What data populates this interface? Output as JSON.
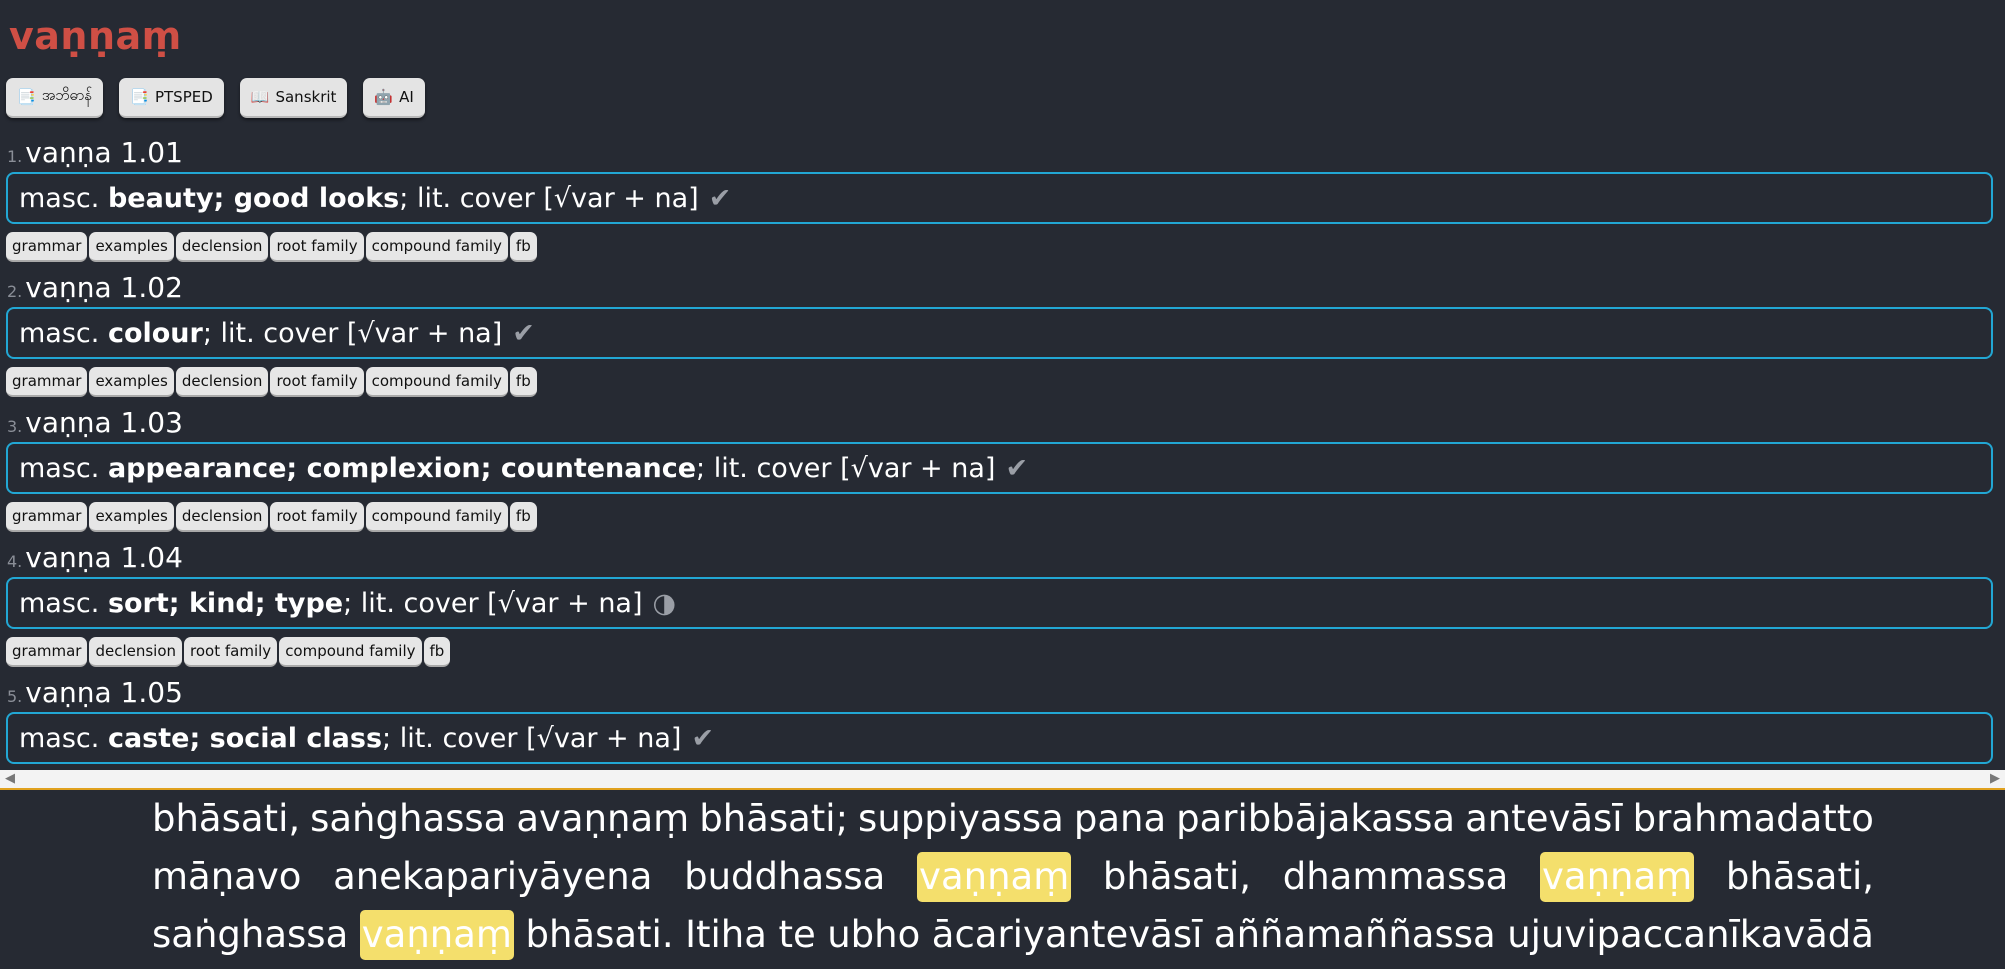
{
  "headword": "vaṇṇaṃ",
  "toolbar": [
    {
      "icon": "📑",
      "label": "အဘိဓာန်"
    },
    {
      "icon": "📑",
      "label": "PTSPED"
    },
    {
      "icon": "📖",
      "label": "Sanskrit"
    },
    {
      "icon": "🤖",
      "label": "AI"
    }
  ],
  "entries": [
    {
      "num": "1.",
      "word": "vaṇṇa 1.01",
      "pos": "masc.",
      "meaning": "beauty; good looks",
      "lit": "; lit. cover [√var + na]",
      "mark": "✔",
      "tags": [
        "grammar",
        "examples",
        "declension",
        "root family",
        "compound family",
        "fb"
      ]
    },
    {
      "num": "2.",
      "word": "vaṇṇa 1.02",
      "pos": "masc.",
      "meaning": "colour",
      "lit": "; lit. cover [√var + na]",
      "mark": "✔",
      "tags": [
        "grammar",
        "examples",
        "declension",
        "root family",
        "compound family",
        "fb"
      ]
    },
    {
      "num": "3.",
      "word": "vaṇṇa 1.03",
      "pos": "masc.",
      "meaning": "appearance; complexion; countenance",
      "lit": "; lit. cover [√var + na]",
      "mark": "✔",
      "tags": [
        "grammar",
        "examples",
        "declension",
        "root family",
        "compound family",
        "fb"
      ]
    },
    {
      "num": "4.",
      "word": "vaṇṇa 1.04",
      "pos": "masc.",
      "meaning": "sort; kind; type",
      "lit": "; lit. cover [√var + na]",
      "mark": "◑",
      "tags": [
        "grammar",
        "declension",
        "root family",
        "compound family",
        "fb"
      ]
    },
    {
      "num": "5.",
      "word": "vaṇṇa 1.05",
      "pos": "masc.",
      "meaning": "caste; social class",
      "lit": "; lit. cover [√var + na]",
      "mark": "✔",
      "tags": []
    }
  ],
  "reader": {
    "line1": [
      "bhāsati,",
      "saṅghassa",
      "avaṇṇaṃ",
      "bhāsati;",
      "suppiyassa",
      "pana",
      "paribbājakassa",
      "antevāsī",
      "brahmadatto"
    ],
    "line2": [
      "māṇavo",
      "anekapariyāyena",
      "buddhassa",
      "vaṇṇaṃ",
      "bhāsati,",
      "dhammassa",
      "vaṇṇaṃ",
      "bhāsati,"
    ],
    "line3": [
      "saṅghassa",
      "vaṇṇaṃ",
      "bhāsati.",
      "Itiha",
      "te",
      "ubho",
      "ācariyantevāsī",
      "aññamaññassa",
      "ujuvipaccanīkavādā"
    ],
    "highlight_word": "vaṇṇaṃ",
    "highlight_color": "#f4df6c"
  },
  "colors": {
    "background": "#262a33",
    "headword": "#cf4f45",
    "meaning_border": "#22a7d4",
    "scroll_accent": "#e0a11e"
  }
}
